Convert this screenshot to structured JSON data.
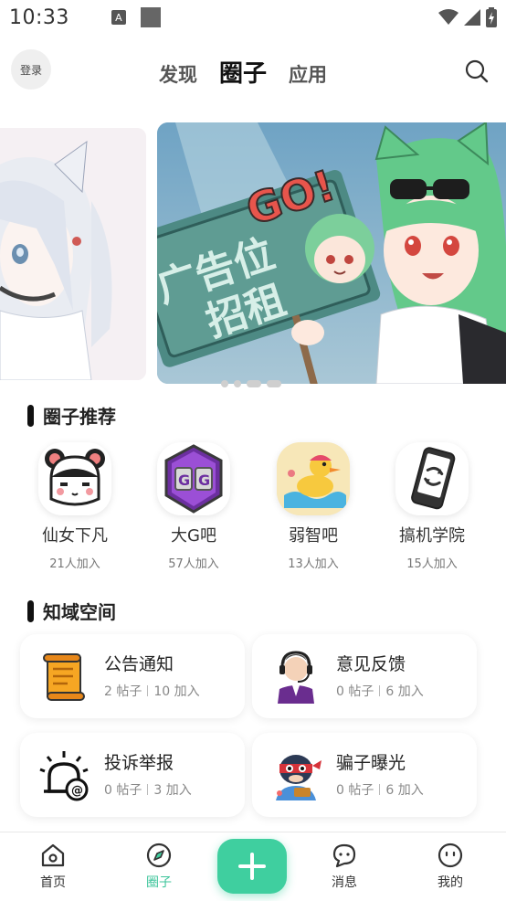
{
  "status_bar": {
    "time": "10:33",
    "notif_letter": "A"
  },
  "top_nav": {
    "login_label": "登录",
    "tabs": [
      {
        "label": "发现",
        "active": false
      },
      {
        "label": "圈子",
        "active": true
      },
      {
        "label": "应用",
        "active": false
      }
    ]
  },
  "banner": {
    "text_line1": "广告位",
    "text_line2": "招租",
    "go_text": "GO!"
  },
  "recommend": {
    "title": "圈子推荐",
    "items": [
      {
        "name": "仙女下凡",
        "count": "21人加入",
        "icon": "fairy-icon"
      },
      {
        "name": "大G吧",
        "count": "57人加入",
        "icon": "game-guardian-icon"
      },
      {
        "name": "弱智吧",
        "count": "13人加入",
        "icon": "duck-icon"
      },
      {
        "name": "搞机学院",
        "count": "15人加入",
        "icon": "phone-icon"
      }
    ]
  },
  "spaces": {
    "title": "知域空间",
    "items": [
      {
        "name": "公告通知",
        "posts": "2 帖子",
        "joins": "10 加入",
        "icon": "scroll-icon"
      },
      {
        "name": "意见反馈",
        "posts": "0 帖子",
        "joins": "6 加入",
        "icon": "support-agent-icon"
      },
      {
        "name": "投诉举报",
        "posts": "0 帖子",
        "joins": "3 加入",
        "icon": "alarm-icon"
      },
      {
        "name": "骗子曝光",
        "posts": "0 帖子",
        "joins": "6 加入",
        "icon": "thief-icon"
      }
    ]
  },
  "bottom_nav": {
    "items": [
      {
        "label": "首页",
        "icon": "home-icon",
        "active": false
      },
      {
        "label": "圈子",
        "icon": "compass-icon",
        "active": true
      },
      {
        "label": "消息",
        "icon": "chat-icon",
        "active": false
      },
      {
        "label": "我的",
        "icon": "profile-icon",
        "active": false
      }
    ],
    "fab_icon": "plus-icon"
  },
  "colors": {
    "accent": "#3fcf9f",
    "accent_text": "#3cc49a"
  }
}
